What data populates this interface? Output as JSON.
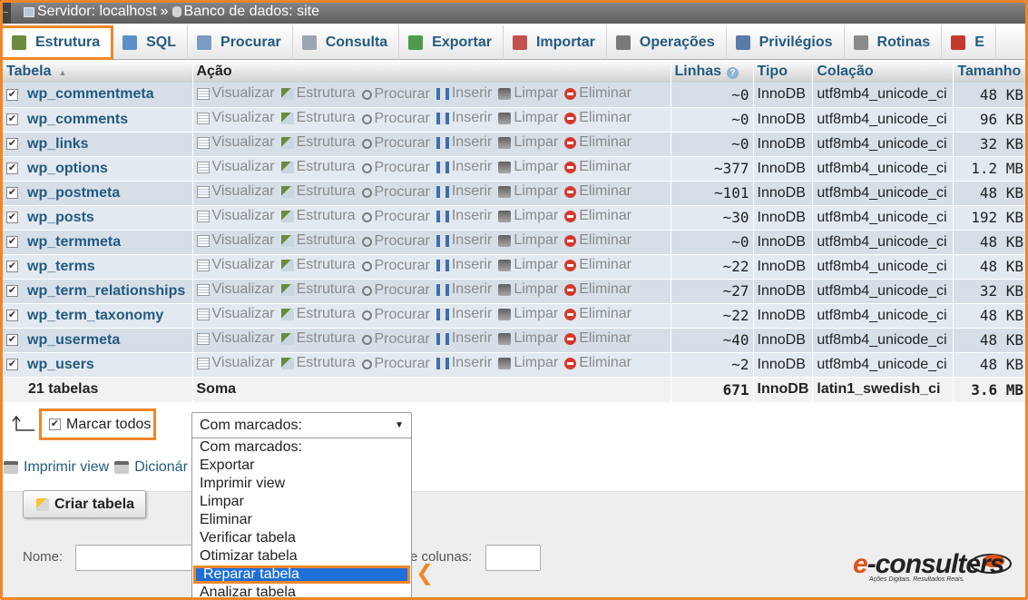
{
  "breadcrumb": {
    "server_label": "Servidor: localhost",
    "separator": "»",
    "db_label": "Banco de dados: site"
  },
  "tabs": [
    {
      "label": "Estrutura",
      "icon": "structure-icon",
      "active": true
    },
    {
      "label": "SQL",
      "icon": "sql-icon"
    },
    {
      "label": "Procurar",
      "icon": "search-icon"
    },
    {
      "label": "Consulta",
      "icon": "query-icon"
    },
    {
      "label": "Exportar",
      "icon": "export-icon"
    },
    {
      "label": "Importar",
      "icon": "import-icon"
    },
    {
      "label": "Operações",
      "icon": "wrench-icon"
    },
    {
      "label": "Privilégios",
      "icon": "privileges-icon"
    },
    {
      "label": "Rotinas",
      "icon": "gears-icon"
    },
    {
      "label": "E",
      "icon": "clock-icon"
    }
  ],
  "table": {
    "headers": {
      "table": "Tabela",
      "action": "Ação",
      "rows": "Linhas",
      "type": "Tipo",
      "collation": "Colação",
      "size": "Tamanho"
    },
    "actions": [
      "Visualizar",
      "Estrutura",
      "Procurar",
      "Inserir",
      "Limpar",
      "Eliminar"
    ],
    "rows": [
      {
        "name": "wp_commentmeta",
        "rows": "~0",
        "type": "InnoDB",
        "collation": "utf8mb4_unicode_ci",
        "size": "48 KB"
      },
      {
        "name": "wp_comments",
        "rows": "~0",
        "type": "InnoDB",
        "collation": "utf8mb4_unicode_ci",
        "size": "96 KB"
      },
      {
        "name": "wp_links",
        "rows": "~0",
        "type": "InnoDB",
        "collation": "utf8mb4_unicode_ci",
        "size": "32 KB"
      },
      {
        "name": "wp_options",
        "rows": "~377",
        "type": "InnoDB",
        "collation": "utf8mb4_unicode_ci",
        "size": "1.2 MB"
      },
      {
        "name": "wp_postmeta",
        "rows": "~101",
        "type": "InnoDB",
        "collation": "utf8mb4_unicode_ci",
        "size": "48 KB"
      },
      {
        "name": "wp_posts",
        "rows": "~30",
        "type": "InnoDB",
        "collation": "utf8mb4_unicode_ci",
        "size": "192 KB"
      },
      {
        "name": "wp_termmeta",
        "rows": "~0",
        "type": "InnoDB",
        "collation": "utf8mb4_unicode_ci",
        "size": "48 KB"
      },
      {
        "name": "wp_terms",
        "rows": "~22",
        "type": "InnoDB",
        "collation": "utf8mb4_unicode_ci",
        "size": "48 KB"
      },
      {
        "name": "wp_term_relationships",
        "rows": "~27",
        "type": "InnoDB",
        "collation": "utf8mb4_unicode_ci",
        "size": "32 KB"
      },
      {
        "name": "wp_term_taxonomy",
        "rows": "~22",
        "type": "InnoDB",
        "collation": "utf8mb4_unicode_ci",
        "size": "48 KB"
      },
      {
        "name": "wp_usermeta",
        "rows": "~40",
        "type": "InnoDB",
        "collation": "utf8mb4_unicode_ci",
        "size": "48 KB"
      },
      {
        "name": "wp_users",
        "rows": "~2",
        "type": "InnoDB",
        "collation": "utf8mb4_unicode_ci",
        "size": "48 KB"
      }
    ],
    "summary": {
      "count": "21 tabelas",
      "label": "Soma",
      "rows": "671",
      "type": "InnoDB",
      "collation": "latin1_swedish_ci",
      "size": "3.6 MB"
    }
  },
  "bulk": {
    "check_all": "Marcar todos",
    "select_value": "Com marcados:",
    "options": [
      "Com marcados:",
      "Exportar",
      "Imprimir view",
      "Limpar",
      "Eliminar",
      "Verificar tabela",
      "Otimizar tabela",
      "Reparar tabela",
      "Analizar tabela"
    ],
    "selected_option": "Reparar tabela"
  },
  "links": {
    "print_view": "Imprimir view",
    "dictionary": "Dicionár"
  },
  "create": {
    "button": "Criar tabela",
    "name_label": "Nome:",
    "columns_label": "e colunas:"
  },
  "logo": {
    "word_e": "e",
    "word_rest": "-consulters",
    "tagline": "Ações Digitais. Resultados Reais."
  },
  "colors": {
    "accent": "#f0862a",
    "link": "#235a81",
    "selection": "#1e6fd9"
  }
}
